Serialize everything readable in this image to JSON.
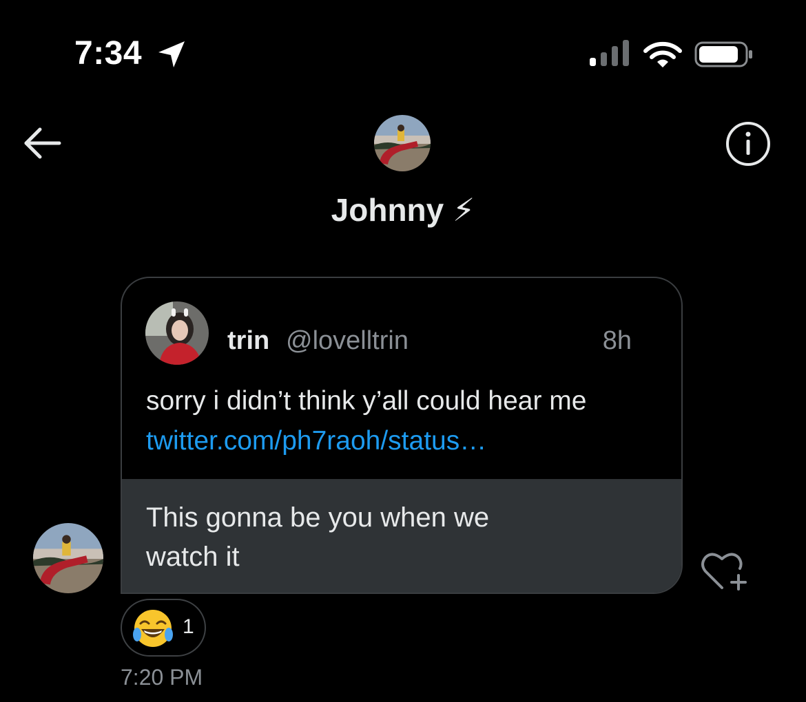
{
  "status_bar": {
    "time": "7:34",
    "icons": [
      "location-icon",
      "signal-icon",
      "wifi-icon",
      "battery-icon"
    ]
  },
  "header": {
    "title": "Johnny ⚡",
    "back_icon": "arrow-left-icon",
    "info_icon": "info-circle-icon"
  },
  "message": {
    "quoted_tweet": {
      "name": "trin",
      "handle": "@lovelltrin",
      "time": "8h",
      "text": "sorry i didn’t think y’all could hear me",
      "link": "twitter.com/ph7raoh/status…"
    },
    "text": "This gonna be you when we watch it",
    "reaction": {
      "emoji": "😂",
      "count": "1"
    },
    "timestamp": "7:20 PM"
  },
  "colors": {
    "background": "#000000",
    "bubble": "#2f3336",
    "link": "#1d9bf0",
    "secondary_text": "#8b9096",
    "bolt": "#f4b400"
  }
}
